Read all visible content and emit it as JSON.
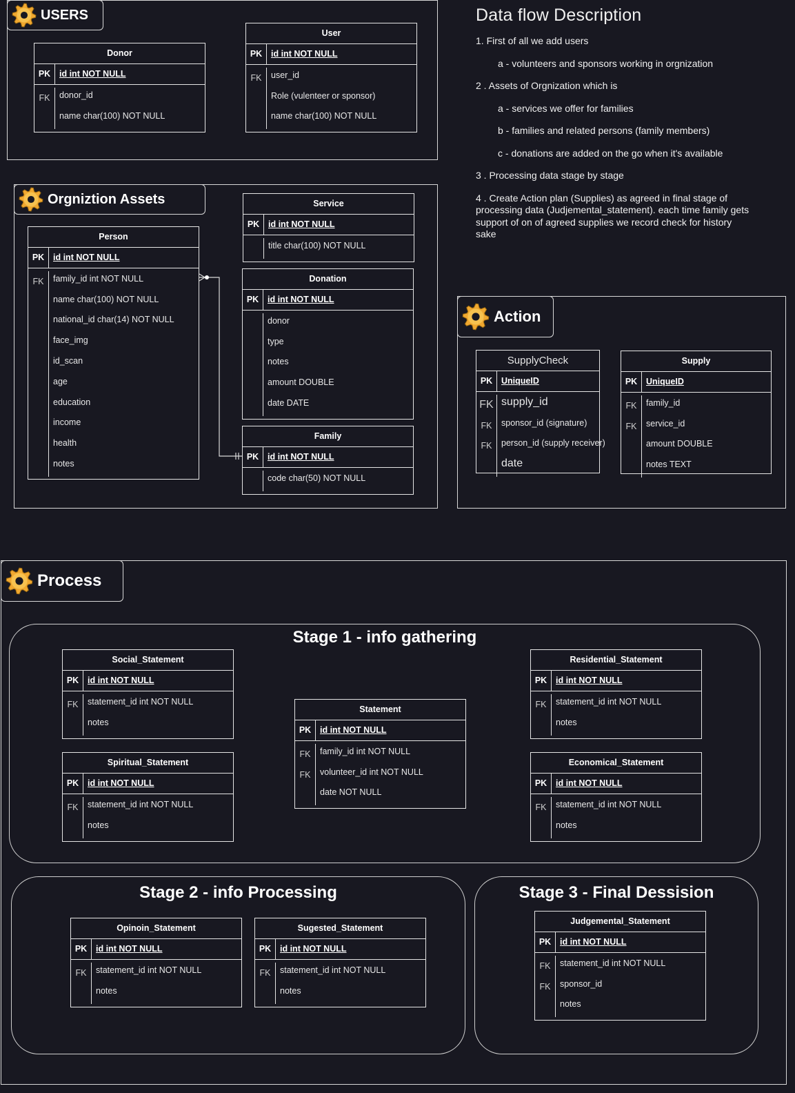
{
  "groups": {
    "users": "USERS",
    "assets": "Orgniztion Assets",
    "action": "Action",
    "process": "Process"
  },
  "description": {
    "title": "Data flow Description",
    "lines": [
      "1. First  of all we add users",
      "a - volunteers and sponsors working in orgnization",
      "2 . Assets of  Orgnization which is",
      "a -  services we offer for families",
      "b - families and related persons (family members)",
      "c - donations are added on the go when it's available",
      "3 . Processing data  stage by stage",
      "4 . Create Action plan (Supplies) as agreed in final stage of processing data (Judjemental_statement). each time family gets support of on of agreed supplies we record check for history sake"
    ]
  },
  "stages": {
    "s1": "Stage 1 - info gathering",
    "s2": "Stage 2 - info Processing",
    "s3": "Stage 3 - Final Dessision"
  },
  "tables": {
    "donor": {
      "name": "Donor",
      "pk_key": "PK",
      "pk": "id int NOT NULL",
      "keys": [
        "FK",
        ""
      ],
      "fields": [
        "donor_id",
        "name char(100) NOT NULL"
      ]
    },
    "user": {
      "name": "User",
      "pk_key": "PK",
      "pk": "id int NOT NULL",
      "keys": [
        "FK",
        "",
        ""
      ],
      "fields": [
        "user_id",
        "Role (vulenteer or sponsor)",
        "name char(100) NOT NULL"
      ]
    },
    "person": {
      "name": "Person",
      "pk_key": "PK",
      "pk": "id int NOT NULL",
      "keys": [
        "FK",
        "",
        "",
        "",
        "",
        "",
        "",
        "",
        "",
        ""
      ],
      "fields": [
        "family_id int NOT NULL",
        "name char(100) NOT NULL",
        "national_id char(14) NOT NULL",
        "face_img",
        "id_scan",
        "age",
        "education",
        "income",
        "health",
        "notes"
      ]
    },
    "service": {
      "name": "Service",
      "pk_key": "PK",
      "pk": "id int NOT NULL",
      "keys": [
        ""
      ],
      "fields": [
        "title char(100)  NOT NULL"
      ]
    },
    "donation": {
      "name": "Donation",
      "pk_key": "PK",
      "pk": "id int NOT NULL",
      "keys": [
        "",
        "",
        "",
        "",
        ""
      ],
      "fields": [
        "donor",
        "type",
        "notes",
        "amount   DOUBLE",
        "date    DATE"
      ]
    },
    "family": {
      "name": "Family",
      "pk_key": "PK",
      "pk": "id int NOT NULL",
      "keys": [
        ""
      ],
      "fields": [
        "code char(50) NOT NULL"
      ]
    },
    "supplycheck": {
      "name": "SupplyCheck",
      "pk_key": "PK",
      "pk": "UniqueID",
      "keys": [
        "FK",
        "FK",
        "FK",
        ""
      ],
      "fields": [
        "supply_id",
        "sponsor_id (signature)",
        "person_id (supply receiver)",
        "date"
      ]
    },
    "supply": {
      "name": "Supply",
      "pk_key": "PK",
      "pk": "UniqueID",
      "keys": [
        "FK",
        "FK",
        "",
        ""
      ],
      "fields": [
        "family_id",
        "service_id",
        "amount   DOUBLE",
        "notes    TEXT"
      ]
    },
    "social": {
      "name": "Social_Statement",
      "pk_key": "PK",
      "pk": "id int NOT NULL",
      "keys": [
        "FK",
        ""
      ],
      "fields": [
        "statement_id int  NOT NULL",
        "notes"
      ]
    },
    "residential": {
      "name": "Residential_Statement",
      "pk_key": "PK",
      "pk": "id int NOT NULL",
      "keys": [
        "FK",
        ""
      ],
      "fields": [
        "statement_id int  NOT NULL",
        "notes"
      ]
    },
    "statement": {
      "name": "Statement",
      "pk_key": "PK",
      "pk": "id int NOT NULL",
      "keys": [
        "FK",
        "FK",
        ""
      ],
      "fields": [
        "family_id  int  NOT NULL",
        "volunteer_id int NOT NULL",
        "date NOT NULL"
      ]
    },
    "spiritual": {
      "name": "Spiritual_Statement",
      "pk_key": "PK",
      "pk": "id int NOT NULL",
      "keys": [
        "FK",
        ""
      ],
      "fields": [
        "statement_id int  NOT NULL",
        "notes"
      ]
    },
    "economical": {
      "name": "Economical_Statement",
      "pk_key": "PK",
      "pk": "id int NOT NULL",
      "keys": [
        "FK",
        ""
      ],
      "fields": [
        "statement_id int  NOT NULL",
        "notes"
      ]
    },
    "opinion": {
      "name": "Opinoin_Statement",
      "pk_key": "PK",
      "pk": "id int NOT NULL",
      "keys": [
        "FK",
        ""
      ],
      "fields": [
        "statement_id int  NOT NULL",
        "notes"
      ]
    },
    "suggested": {
      "name": "Sugested_Statement",
      "pk_key": "PK",
      "pk": "id int NOT NULL",
      "keys": [
        "FK",
        ""
      ],
      "fields": [
        "statement_id int  NOT NULL",
        "notes"
      ]
    },
    "judgemental": {
      "name": "Judgemental_Statement",
      "pk_key": "PK",
      "pk": "id int NOT NULL",
      "keys": [
        "FK",
        "FK",
        ""
      ],
      "fields": [
        "statement_id int  NOT NULL",
        "sponsor_id",
        "notes"
      ]
    }
  },
  "colors": {
    "background": "#181821",
    "line": "#e6e6e6",
    "gear": "#f0a830"
  }
}
